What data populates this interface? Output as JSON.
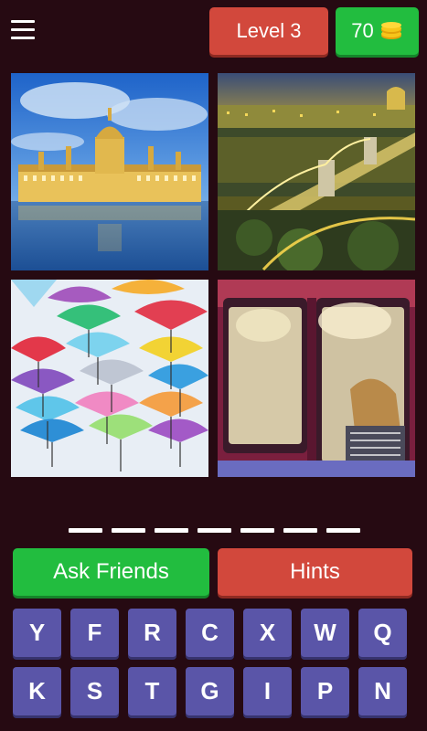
{
  "header": {
    "level_label": "Level 3",
    "coins": "70"
  },
  "puzzle": {
    "images": [
      {
        "subject": "parliament-at-dusk"
      },
      {
        "subject": "chain-bridge-night"
      },
      {
        "subject": "colorful-umbrellas"
      },
      {
        "subject": "tram-window-passenger"
      }
    ],
    "answer_length": 7
  },
  "actions": {
    "ask_friends_label": "Ask Friends",
    "hints_label": "Hints"
  },
  "keyboard": {
    "row1": [
      "Y",
      "F",
      "R",
      "C",
      "X",
      "W",
      "Q"
    ],
    "row2": [
      "K",
      "S",
      "T",
      "G",
      "I",
      "P",
      "N"
    ]
  },
  "colors": {
    "background": "#260a12",
    "level_button": "#d2483c",
    "coins_button": "#22bd3f",
    "ask_friends": "#22bd3f",
    "hints": "#d2483c",
    "key": "#5a55a8"
  },
  "icons": {
    "menu": "hamburger-menu-icon",
    "coins": "coin-stack-icon"
  }
}
